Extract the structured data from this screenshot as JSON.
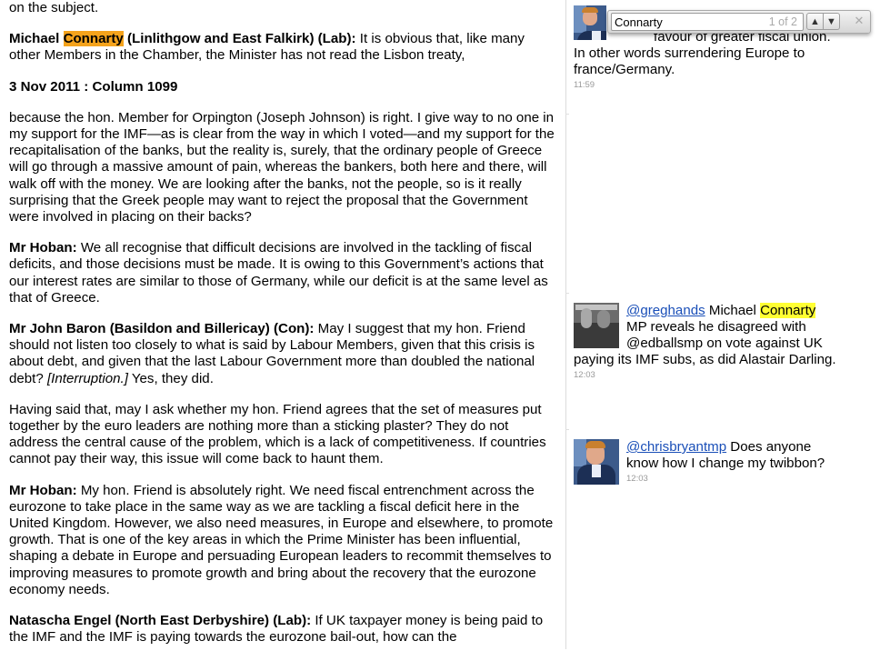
{
  "find_bar": {
    "query": "Connarty",
    "count": "1 of 2",
    "prev_icon": "▲",
    "next_icon": "▼",
    "close_icon": "✕"
  },
  "hansard": {
    "intro_tail": "on the subject.",
    "p1": {
      "speaker_pre": "Michael ",
      "speaker_match": "Connarty",
      "speaker_post": " (Linlithgow and East Falkirk) (Lab):",
      "text": " It is obvious that, like many other Members in the Chamber, the Minister has not read the Lisbon treaty,"
    },
    "column_heading": "3 Nov 2011 : Column 1099",
    "p2": "because the hon. Member for Orpington (Joseph Johnson) is right. I give way to no one in my support for the IMF—as is clear from the way in which I voted—and my support for the recapitalisation of the banks, but the reality is, surely, that the ordinary people of Greece will go through a massive amount of pain, whereas the bankers, both here and there, will walk off with the money. We are looking after the banks, not the people, so is it really surprising that the Greek people may want to reject the proposal that the Government were involved in placing on their backs?",
    "p3": {
      "speaker": "Mr Hoban:",
      "text": " We all recognise that difficult decisions are involved in the tackling of fiscal deficits, and those decisions must be made. It is owing to this Government’s actions that our interest rates are similar to those of Germany, while our deficit is at the same level as that of Greece."
    },
    "p4": {
      "speaker": "Mr John Baron (Basildon and Billericay) (Con):",
      "text": " May I suggest that my hon. Friend should not listen too closely to what is said by Labour Members, given that this crisis is about debt, and given that the last Labour Government more than doubled the national debt? ",
      "interruption": "[Interruption.]",
      "text2": " Yes, they did."
    },
    "p5": "Having said that, may I ask whether my hon. Friend agrees that the set of measures put together by the euro leaders are nothing more than a sticking plaster? They do not address the central cause of the problem, which is a lack of competitiveness. If countries cannot pay their way, this issue will come back to haunt them.",
    "p6": {
      "speaker": "Mr Hoban:",
      "text": " My hon. Friend is absolutely right. We need fiscal entrenchment across the eurozone to take place in the same way as we are tackling a fiscal deficit here in the United Kingdom. However, we also need measures, in Europe and elsewhere, to promote growth. That is one of the key areas in which the Prime Minister has been influential, shaping a debate in Europe and persuading European leaders to recommit themselves to improving measures to promote growth and bring about the recovery that the eurozone economy needs."
    },
    "p7": {
      "speaker": "Natascha Engel (North East Derbyshire) (Lab):",
      "text": " If UK taxpayer money is being paid to the IMF and the IMF is paying towards the eurozone bail-out, how can the"
    }
  },
  "tweets": [
    {
      "avatar": "man-with-microphone-avatar",
      "text_a": "favour of greater fiscal union. In other words surrendering Europe to france/Germany.",
      "time": "11:59"
    },
    {
      "avatar": "group-photo-avatar",
      "handle": "@greghands",
      "text_pre": " Michael ",
      "match": "Connarty",
      "text_post": " MP reveals he disagreed with @edballsmp on vote against UK paying its IMF subs, as did Alastair Darling.",
      "time": "12:03"
    },
    {
      "avatar": "man-with-microphone-avatar",
      "handle": "@chrisbryantmp",
      "text_post": " Does anyone know how I change my twibbon?",
      "time": "12:03"
    }
  ]
}
